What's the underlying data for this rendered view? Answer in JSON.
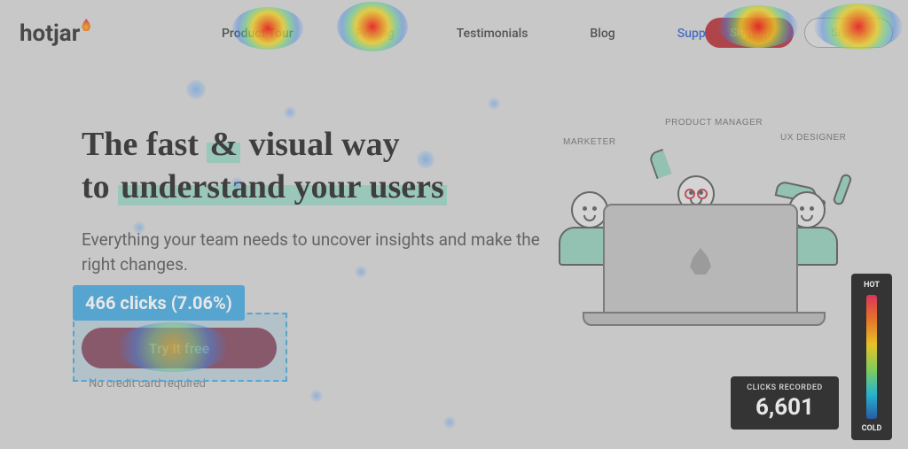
{
  "brand": {
    "name": "hotjar"
  },
  "nav": {
    "items": [
      {
        "label": "Product Tour"
      },
      {
        "label": "Pricing"
      },
      {
        "label": "Testimonials"
      },
      {
        "label": "Blog"
      },
      {
        "label": "Support"
      }
    ],
    "cta_primary": "Sign up",
    "cta_secondary": "Sign in"
  },
  "hero": {
    "h1_line1_a": "The fast ",
    "h1_line1_amp": "&",
    "h1_line1_b": " visual way",
    "h1_line2_a": "to ",
    "h1_line2_hl": "understand your users",
    "sub": "Everything your team needs to uncover insights and make the right changes.",
    "try_label": "Try it free",
    "nocard": "No credit card required"
  },
  "illustration": {
    "roles": {
      "marketer": "MARKETER",
      "pm": "PRODUCT MANAGER",
      "ux": "UX DESIGNER"
    }
  },
  "heatmap": {
    "tooltip": "466 clicks (7.06%)",
    "clicks_recorded_label": "CLICKS RECORDED",
    "clicks_recorded_value": "6,601",
    "scale_hot": "HOT",
    "scale_cold": "COLD"
  }
}
